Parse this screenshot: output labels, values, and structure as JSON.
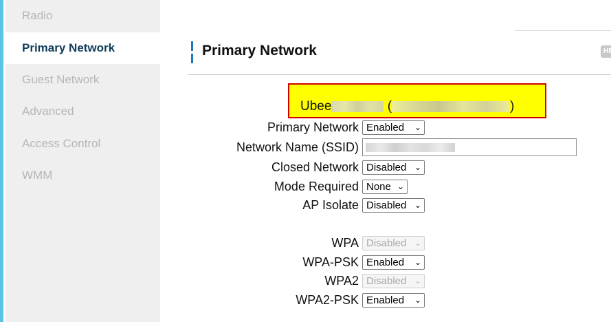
{
  "sidebar": {
    "items": [
      {
        "label": "Radio"
      },
      {
        "label": "Primary Network",
        "active": true
      },
      {
        "label": "Guest Network"
      },
      {
        "label": "Advanced"
      },
      {
        "label": "Access Control"
      },
      {
        "label": "WMM"
      }
    ]
  },
  "header": {
    "title": "Primary Network",
    "help_label": "HE"
  },
  "device": {
    "prefix": "Ubee",
    "open_paren": "(",
    "close_paren": ")"
  },
  "form": {
    "primary_network": {
      "label": "Primary Network",
      "value": "Enabled"
    },
    "ssid": {
      "label": "Network Name (SSID)",
      "value": ""
    },
    "closed_network": {
      "label": "Closed Network",
      "value": "Disabled"
    },
    "mode_required": {
      "label": "Mode Required",
      "value": "None"
    },
    "ap_isolate": {
      "label": "AP Isolate",
      "value": "Disabled"
    },
    "wpa": {
      "label": "WPA",
      "value": "Disabled",
      "disabled": true
    },
    "wpa_psk": {
      "label": "WPA-PSK",
      "value": "Enabled"
    },
    "wpa2": {
      "label": "WPA2",
      "value": "Disabled",
      "disabled": true
    },
    "wpa2_psk": {
      "label": "WPA2-PSK",
      "value": "Enabled"
    }
  },
  "colors": {
    "accent": "#1b77b8",
    "highlight": "#ffff00",
    "highlight_border": "#d40000",
    "left_strip": "#5bc4e6"
  },
  "icons": {
    "dropdown": "chevron-down-icon"
  }
}
